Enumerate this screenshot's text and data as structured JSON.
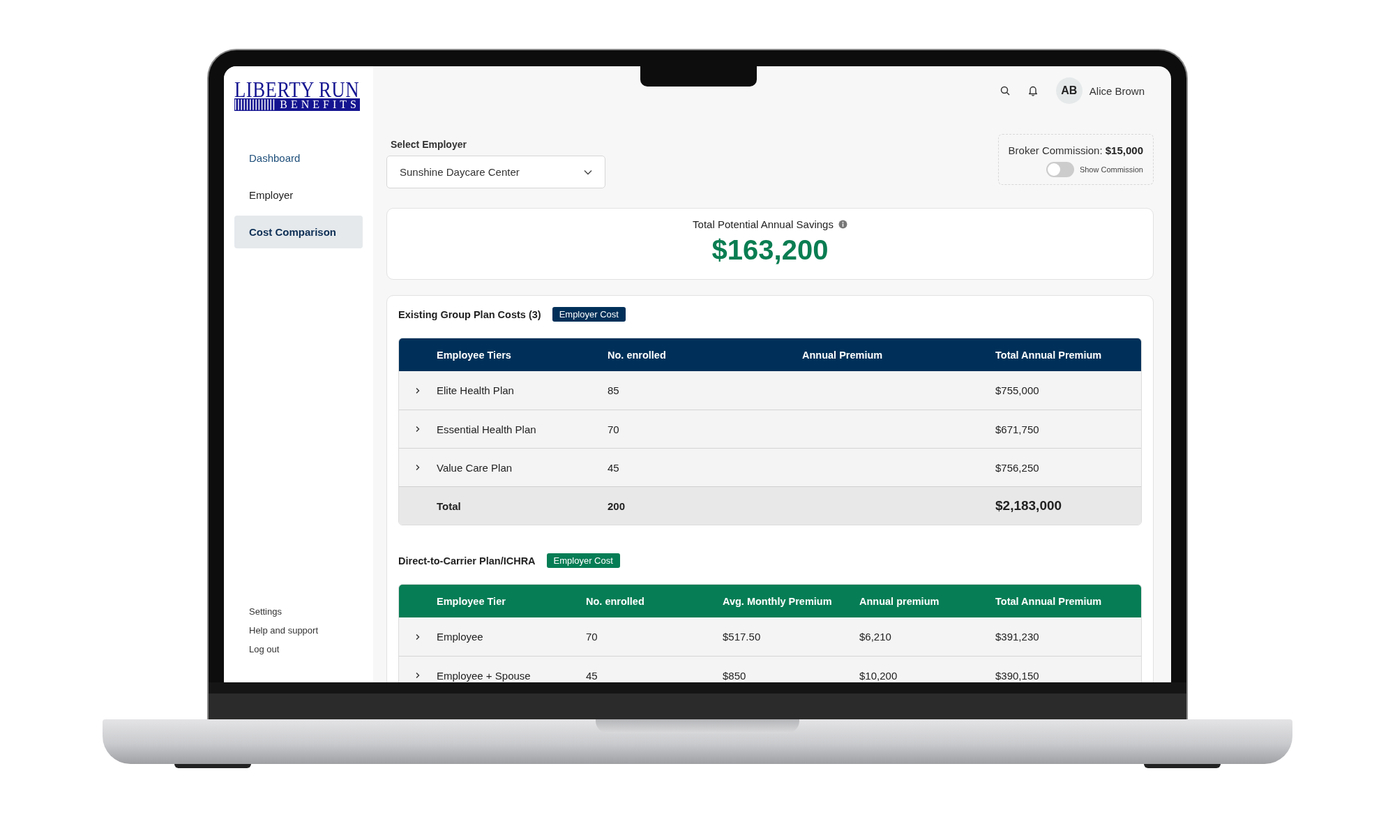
{
  "logo": {
    "line_1": "LIBERTY RUN",
    "line_2": "BENEFITS"
  },
  "sidebar": {
    "items": [
      {
        "label": "Dashboard",
        "selected": false,
        "hovered": true
      },
      {
        "label": "Employer",
        "selected": false,
        "hovered": false
      },
      {
        "label": "Cost Comparison",
        "selected": true,
        "hovered": false
      }
    ],
    "footer_links": [
      "Settings",
      "Help and support",
      "Log out"
    ]
  },
  "header": {
    "user": {
      "initials": "AB",
      "name": "Alice Brown"
    }
  },
  "employer_select": {
    "label": "Select Employer",
    "value": "Sunshine Daycare Center"
  },
  "commission": {
    "label": "Broker Commission:",
    "amount": "$15,000",
    "toggle": {
      "label": "Show Commission",
      "on": false
    }
  },
  "savings": {
    "label": "Total Potential Annual Savings",
    "amount": "$163,200"
  },
  "tables": [
    {
      "title": "Existing Group Plan Costs (3)",
      "badge": "Employer Cost",
      "color": "#003059",
      "kind": "existing",
      "columns": [
        "Employee Tiers",
        "No. enrolled",
        "Annual Premium",
        "Total Annual Premium"
      ],
      "rows": [
        {
          "expanded": false,
          "tier": "Elite Health Plan",
          "enrolled": "85",
          "total": "$755,000"
        },
        {
          "expanded": false,
          "tier": "Essential Health Plan",
          "enrolled": "70",
          "total": "$671,750"
        },
        {
          "expanded": false,
          "tier": "Value Care Plan",
          "enrolled": "45",
          "total": "$756,250"
        }
      ],
      "total": {
        "tier": "Total",
        "enrolled": "200",
        "total": "$2,183,000"
      }
    },
    {
      "title": "Direct-to-Carrier Plan/ICHRA",
      "badge": "Employer Cost",
      "color": "#067d55",
      "kind": "ichra",
      "columns": [
        "Employee Tier",
        "No. enrolled",
        "Avg. Monthly Premium",
        "Annual premium",
        "Total Annual Premium"
      ],
      "rows": [
        {
          "expanded": false,
          "tier": "Employee",
          "enrolled": "70",
          "avg_monthly": "$517.50",
          "annual": "$6,210",
          "total": "$391,230"
        },
        {
          "expanded": false,
          "tier": "Employee + Spouse",
          "enrolled": "45",
          "avg_monthly": "$850",
          "annual": "$10,200",
          "total": "$390,150"
        }
      ]
    }
  ]
}
